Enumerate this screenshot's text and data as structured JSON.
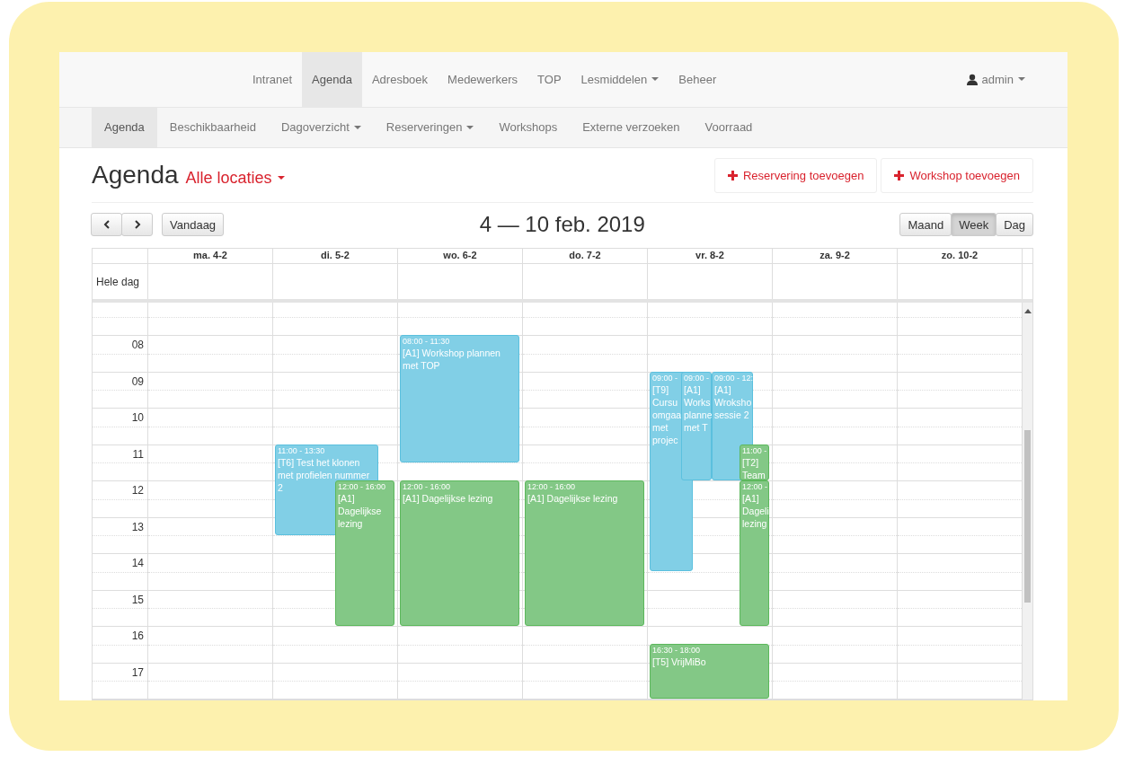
{
  "top_nav": {
    "items": [
      {
        "label": "Intranet",
        "selected": false,
        "dropdown": false
      },
      {
        "label": "Agenda",
        "selected": true,
        "dropdown": false
      },
      {
        "label": "Adresboek",
        "selected": false,
        "dropdown": false
      },
      {
        "label": "Medewerkers",
        "selected": false,
        "dropdown": false
      },
      {
        "label": "TOP",
        "selected": false,
        "dropdown": false
      },
      {
        "label": "Lesmiddelen",
        "selected": false,
        "dropdown": true
      },
      {
        "label": "Beheer",
        "selected": false,
        "dropdown": false
      }
    ],
    "user": "admin"
  },
  "sub_nav": {
    "items": [
      {
        "label": "Agenda",
        "selected": true,
        "dropdown": false
      },
      {
        "label": "Beschikbaarheid",
        "selected": false,
        "dropdown": false
      },
      {
        "label": "Dagoverzicht",
        "selected": false,
        "dropdown": true
      },
      {
        "label": "Reserveringen",
        "selected": false,
        "dropdown": true
      },
      {
        "label": "Workshops",
        "selected": false,
        "dropdown": false
      },
      {
        "label": "Externe verzoeken",
        "selected": false,
        "dropdown": false
      },
      {
        "label": "Voorraad",
        "selected": false,
        "dropdown": false
      }
    ]
  },
  "page": {
    "title": "Agenda",
    "location": "Alle locaties",
    "actions": [
      "Reservering toevoegen",
      "Workshop toevoegen"
    ]
  },
  "toolbar": {
    "today": "Vandaag",
    "range": "4 — 10 feb. 2019",
    "views": [
      {
        "label": "Maand",
        "selected": false
      },
      {
        "label": "Week",
        "selected": true
      },
      {
        "label": "Dag",
        "selected": false
      }
    ]
  },
  "calendar": {
    "days": [
      "ma. 4-2",
      "di. 5-2",
      "wo. 6-2",
      "do. 7-2",
      "vr. 8-2",
      "za. 9-2",
      "zo. 10-2"
    ],
    "all_day_label": "Hele dag",
    "hours": [
      "08",
      "09",
      "10",
      "11",
      "12",
      "13",
      "14",
      "15",
      "16",
      "17"
    ],
    "events": [
      {
        "color": "#81cfe6",
        "time": "11:00 - 13:30",
        "lines": [
          "[T6] Test het klonen",
          "met profielen nummer",
          "2"
        ]
      },
      {
        "color": "#83c886",
        "time": "12:00 - 16:00",
        "lines": [
          "[A1]",
          "Dagelijkse",
          "lezing"
        ]
      },
      {
        "color": "#81cfe6",
        "time": "08:00 - 11:30",
        "lines": [
          "[A1] Workshop plannen",
          "met TOP"
        ]
      },
      {
        "color": "#83c886",
        "time": "12:00 - 16:00",
        "lines": [
          "[A1] Dagelijkse lezing"
        ]
      },
      {
        "color": "#83c886",
        "time": "12:00 - 16:00",
        "lines": [
          "[A1] Dagelijkse lezing"
        ]
      },
      {
        "color": "#81cfe6",
        "time": "09:00 -",
        "lines": [
          "[T9]",
          "Cursu",
          "omgaa",
          "met",
          "projec"
        ]
      },
      {
        "color": "#81cfe6",
        "time": "09:00 -",
        "lines": [
          "[A1]",
          "Works",
          "planne",
          "met T"
        ]
      },
      {
        "color": "#81cfe6",
        "time": "09:00 - 12:",
        "lines": [
          "[A1]",
          "Wroksho",
          "sessie 2"
        ]
      },
      {
        "color": "#83c886",
        "time": "11:00 -",
        "lines": [
          "[T2]",
          "Team"
        ]
      },
      {
        "color": "#83c886",
        "time": "12:00 -",
        "lines": [
          "[A1]",
          "Dageli",
          "lezing"
        ]
      },
      {
        "color": "#83c886",
        "time": "16:30 - 18:00",
        "lines": [
          "[T5] VrijMiBo"
        ]
      }
    ]
  }
}
